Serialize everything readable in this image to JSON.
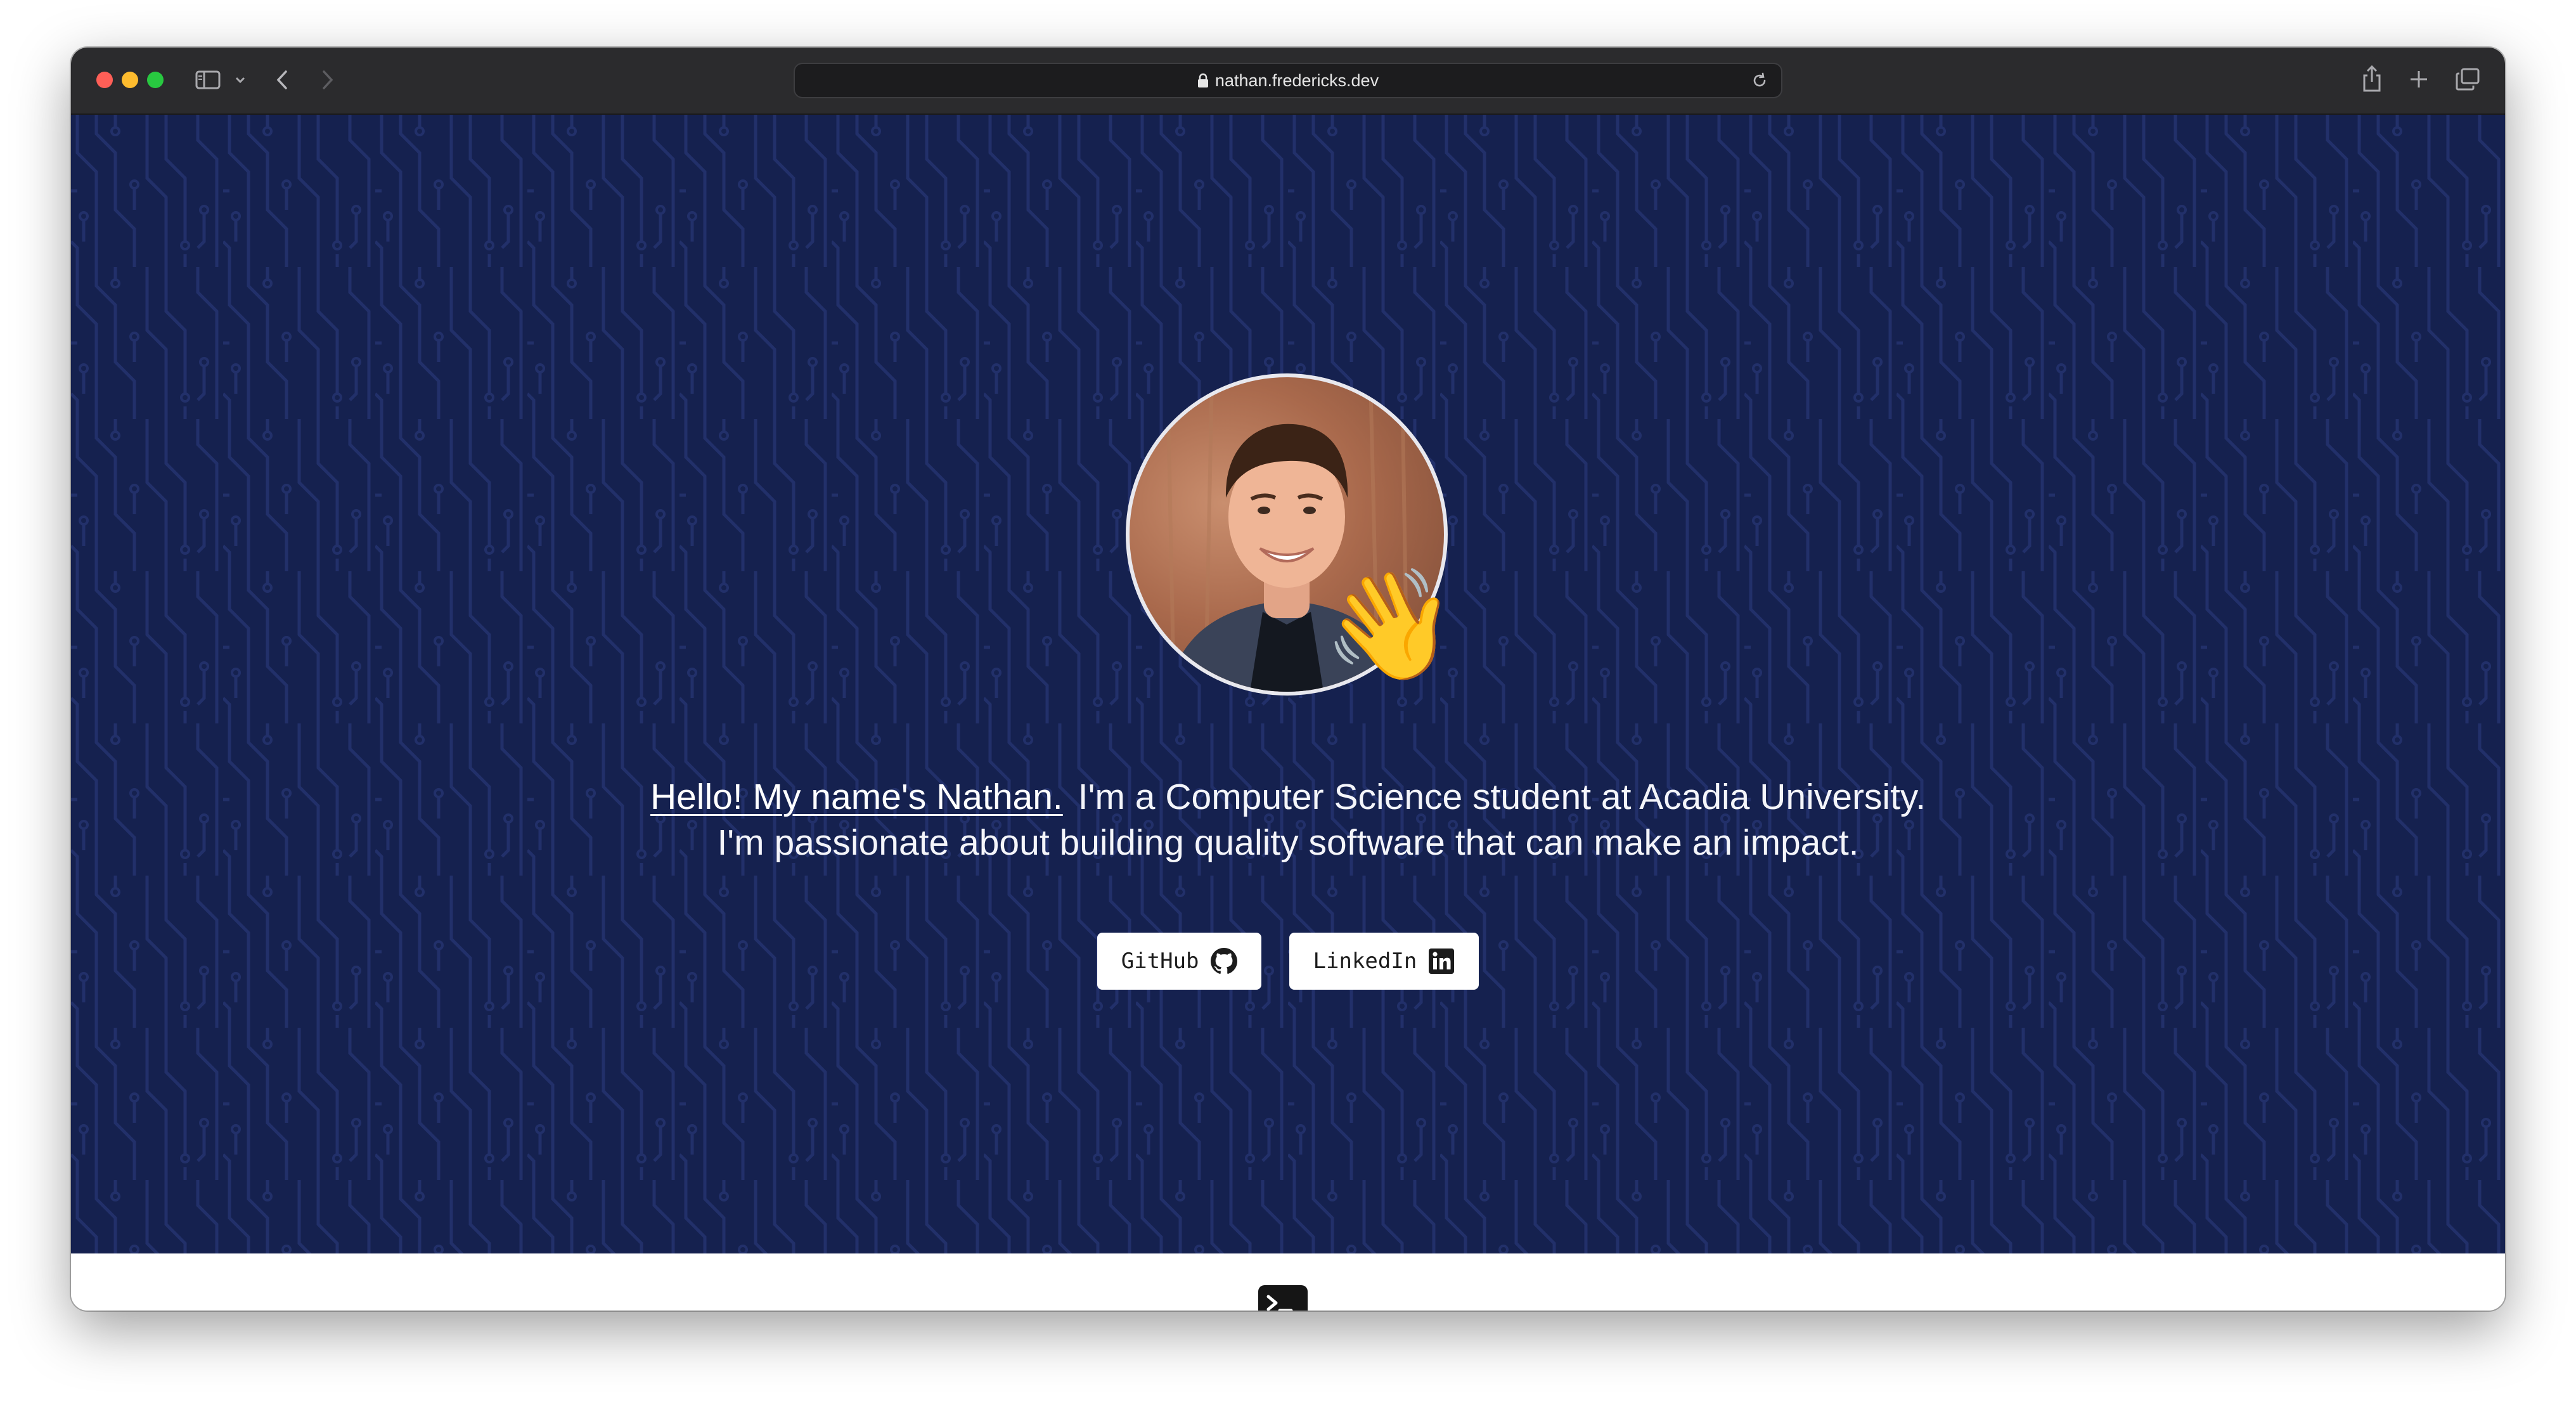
{
  "browser": {
    "url": "nathan.fredericks.dev"
  },
  "hero": {
    "greeting": "Hello! My name's Nathan.",
    "line1_rest": "I'm a Computer Science student at Acadia University.",
    "line2": "I'm passionate about building quality software that can make an impact.",
    "wave_emoji": "👋",
    "buttons": [
      {
        "label": "GitHub",
        "icon": "github-icon"
      },
      {
        "label": "LinkedIn",
        "icon": "linkedin-icon"
      }
    ]
  },
  "colors": {
    "hero_background": "#15214f",
    "toolbar": "#2b2b2d",
    "button_bg": "#ffffff"
  },
  "icons": {
    "sidebar": "sidebar-icon",
    "back": "chevron-left-icon",
    "forward": "chevron-right-icon",
    "lock": "lock-icon",
    "reload": "reload-icon",
    "share": "share-icon",
    "new_tab": "plus-icon",
    "tabs": "tabs-overview-icon",
    "terminal": "terminal-icon"
  }
}
